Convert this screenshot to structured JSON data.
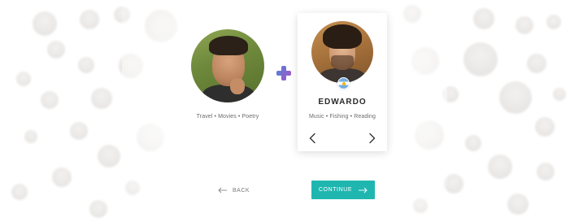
{
  "left_profile": {
    "interests": "Travel • Movies • Poetry"
  },
  "right_profile": {
    "name": "EDWARDO",
    "interests": "Music • Fishing • Reading",
    "flag_icon": "argentina-flag-icon"
  },
  "navigation": {
    "prev_icon": "chevron-left-icon",
    "next_icon": "chevron-right-icon"
  },
  "actions": {
    "back_label": "BACK",
    "continue_label": "CONTINUE",
    "back_icon": "arrow-left-icon",
    "continue_icon": "arrow-right-icon"
  },
  "colors": {
    "accent": "#20b6b0",
    "plus_gradient_start": "#5a7fd6",
    "plus_gradient_end": "#9b5cc7"
  }
}
